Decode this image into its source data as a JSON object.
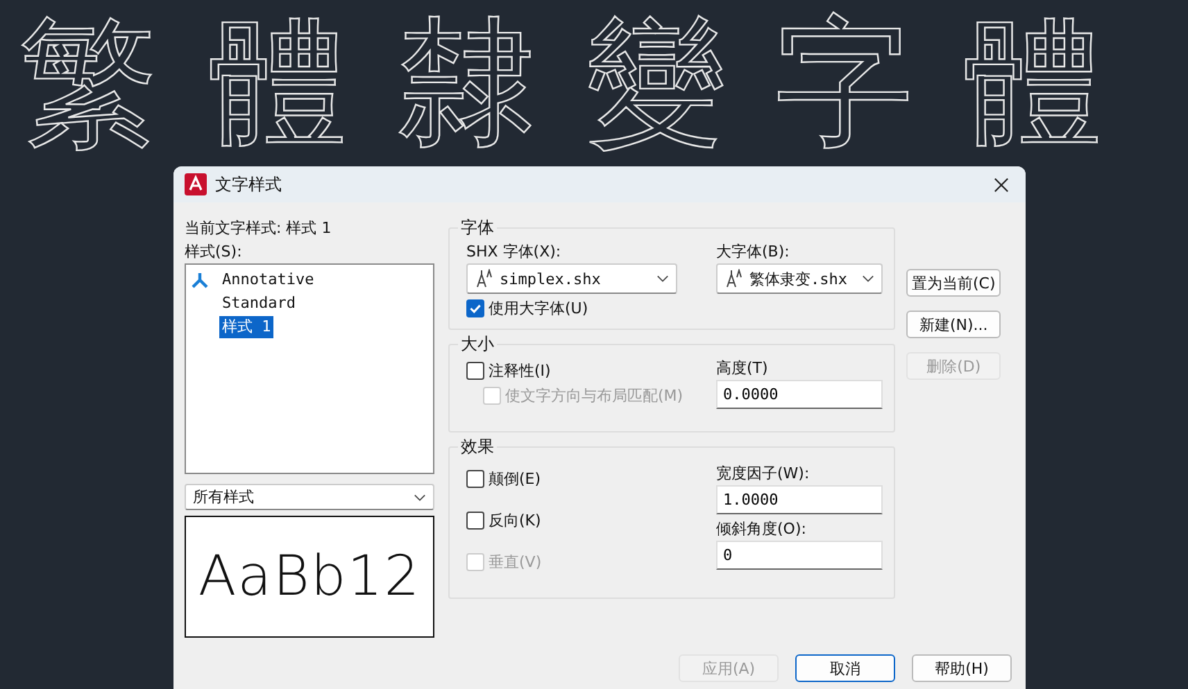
{
  "banner": {
    "text": "繁體隸變字體"
  },
  "window": {
    "title": "文字样式"
  },
  "current_style": "当前文字样式:  样式 1",
  "styles": {
    "label": "样式(S):",
    "items": [
      {
        "name": "Annotative",
        "annotative": true,
        "selected": false
      },
      {
        "name": "Standard",
        "annotative": false,
        "selected": false
      },
      {
        "name": "样式 1",
        "annotative": false,
        "selected": true
      }
    ],
    "filter": "所有样式",
    "preview": "AaBb12"
  },
  "font": {
    "legend": "字体",
    "shx_label": "SHX 字体(X):",
    "shx_value": "simplex.shx",
    "big_label": "大字体(B):",
    "big_value": "繁体隶变.shx",
    "use_bigfont": {
      "label": "使用大字体(U)",
      "checked": true,
      "disabled": false
    }
  },
  "size": {
    "legend": "大小",
    "checks": [
      {
        "label": "注释性(I)",
        "checked": false,
        "disabled": false
      },
      {
        "label": "使文字方向与布局匹配(M)",
        "checked": false,
        "disabled": true
      }
    ],
    "height_label": "高度(T)",
    "height_value": "0.0000"
  },
  "effects": {
    "legend": "效果",
    "checks": [
      {
        "label": "颠倒(E)",
        "checked": false,
        "disabled": false
      },
      {
        "label": "反向(K)",
        "checked": false,
        "disabled": false
      },
      {
        "label": "垂直(V)",
        "checked": false,
        "disabled": true
      }
    ],
    "fields": [
      {
        "label": "宽度因子(W):",
        "value": "1.0000"
      },
      {
        "label": "倾斜角度(O):",
        "value": "0"
      }
    ]
  },
  "side_buttons": [
    {
      "label": "置为当前(C)",
      "disabled": false
    },
    {
      "label": "新建(N)...",
      "disabled": false
    },
    {
      "label": "删除(D)",
      "disabled": true
    }
  ],
  "bottom_buttons": [
    {
      "label": "应用(A)",
      "disabled": true,
      "focused": false
    },
    {
      "label": "取消",
      "disabled": false,
      "focused": true
    },
    {
      "label": "帮助(H)",
      "disabled": false,
      "focused": false
    }
  ]
}
